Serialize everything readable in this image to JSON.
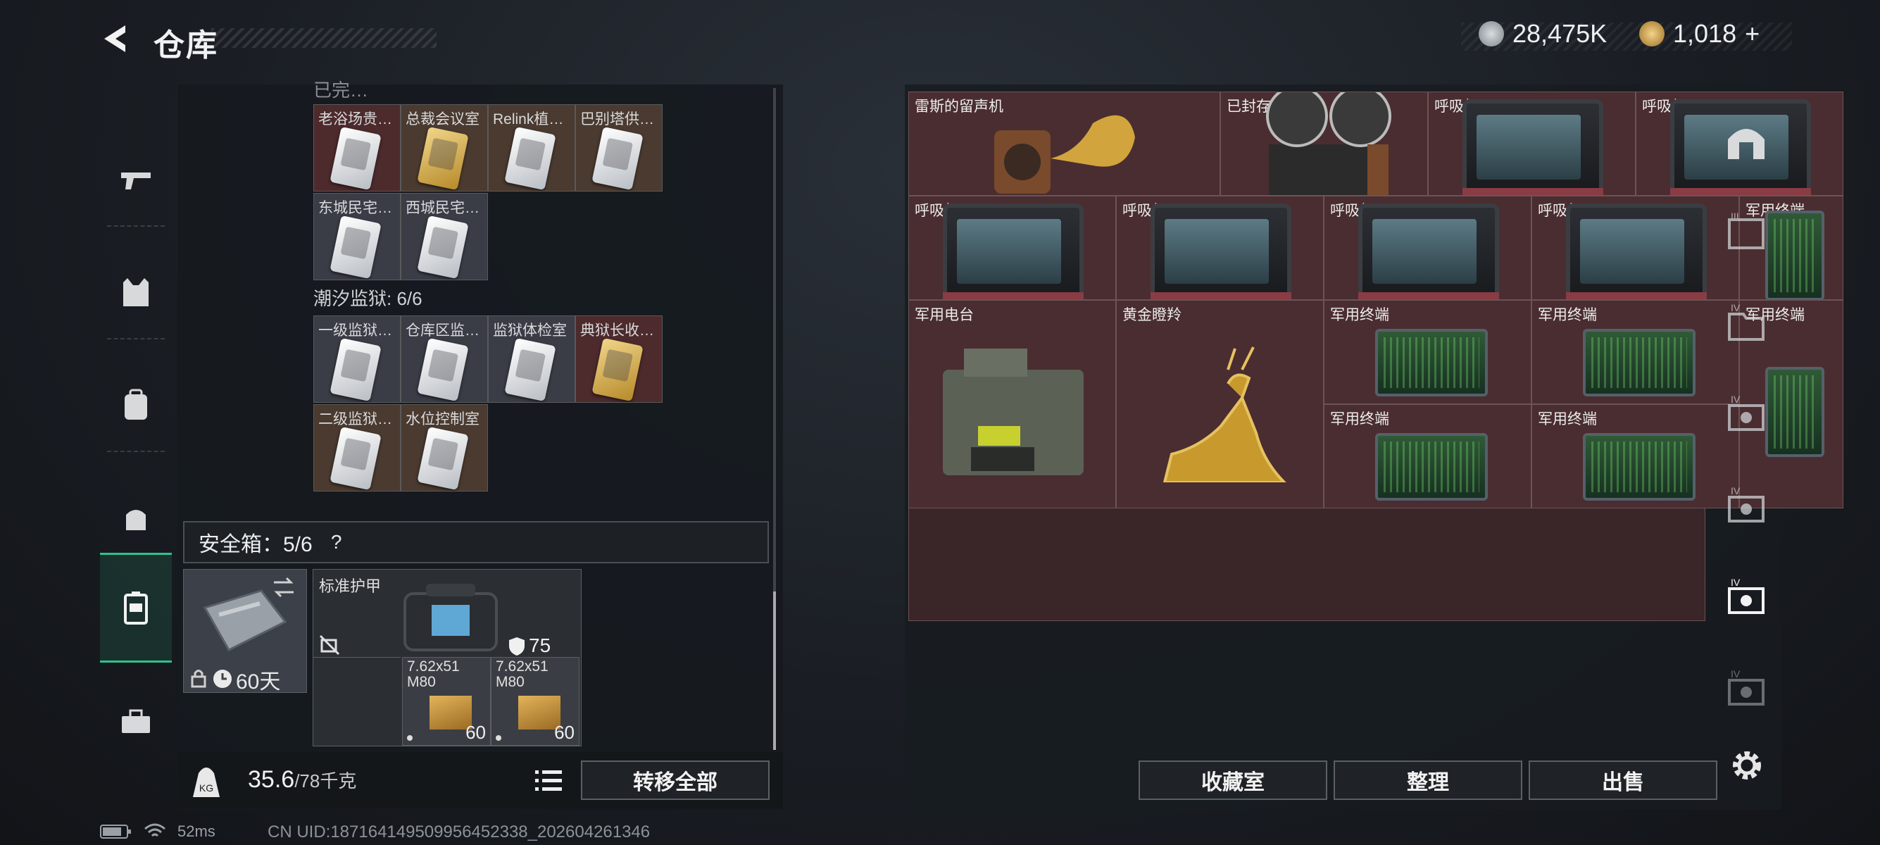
{
  "header": {
    "title": "仓库"
  },
  "currency": {
    "primary": "28,475K",
    "secondary": "1,018",
    "plus": "+"
  },
  "left": {
    "partial_header": "已完…",
    "group1": {
      "items": [
        {
          "label": "老浴场贵…",
          "card": "white",
          "bg": "red"
        },
        {
          "label": "总裁会议室",
          "card": "gold",
          "bg": "gold"
        },
        {
          "label": "Relink植…",
          "card": "white",
          "bg": "gold"
        },
        {
          "label": "巴别塔供…",
          "card": "white",
          "bg": "gold"
        },
        {
          "label": "东城民宅…",
          "card": "white",
          "bg": "white"
        },
        {
          "label": "西城民宅…",
          "card": "white",
          "bg": "white"
        }
      ]
    },
    "group2": {
      "title": "潮汐监狱: 6/6",
      "items": [
        {
          "label": "一级监狱…",
          "card": "white",
          "bg": "white"
        },
        {
          "label": "仓库区监…",
          "card": "white",
          "bg": "white"
        },
        {
          "label": "监狱体检室",
          "card": "white",
          "bg": "white"
        },
        {
          "label": "典狱长收…",
          "card": "gold",
          "bg": "red"
        },
        {
          "label": "二级监狱…",
          "card": "white",
          "bg": "gold"
        },
        {
          "label": "水位控制室",
          "card": "white",
          "bg": "gold"
        }
      ]
    },
    "safe_box": {
      "label": "安全箱：5/6",
      "help": "?",
      "days": "60天"
    },
    "armor": {
      "label": "标准护甲",
      "durability": "75"
    },
    "ammo": [
      {
        "label": "7.62x51 M80",
        "count": "60"
      },
      {
        "label": "7.62x51 M80",
        "count": "60"
      }
    ],
    "weight": {
      "current": "35.6",
      "max": "/78千克"
    },
    "transfer_all": "转移全部"
  },
  "stash": {
    "items": [
      {
        "label": "雷斯的留声机",
        "kind": "gramophone"
      },
      {
        "label": "已封存音源",
        "kind": "reel"
      },
      {
        "label": "呼吸机",
        "kind": "breather"
      },
      {
        "label": "呼吸机",
        "kind": "breather"
      },
      {
        "label": "呼吸机",
        "kind": "breather"
      },
      {
        "label": "呼吸机",
        "kind": "breather"
      },
      {
        "label": "呼吸机",
        "kind": "breather"
      },
      {
        "label": "呼吸机",
        "kind": "breather"
      },
      {
        "label": "军用终端",
        "kind": "terminal-v"
      },
      {
        "label": "军用电台",
        "kind": "radio"
      },
      {
        "label": "黄金瞪羚",
        "kind": "gazelle"
      },
      {
        "label": "军用终端",
        "kind": "terminal"
      },
      {
        "label": "军用终端",
        "kind": "terminal"
      },
      {
        "label": "军用终端",
        "kind": "terminal-v"
      },
      {
        "label": "军用终端",
        "kind": "terminal"
      },
      {
        "label": "军用终端",
        "kind": "terminal"
      }
    ],
    "buttons": {
      "collection": "收藏室",
      "sort": "整理",
      "sell": "出售"
    }
  },
  "status": {
    "latency": "52ms",
    "uid": "CN UID:18716414950995645​2338_202604261346"
  },
  "colors": {
    "accent": "#2fc28a",
    "item_bg": "#4a2d30"
  }
}
